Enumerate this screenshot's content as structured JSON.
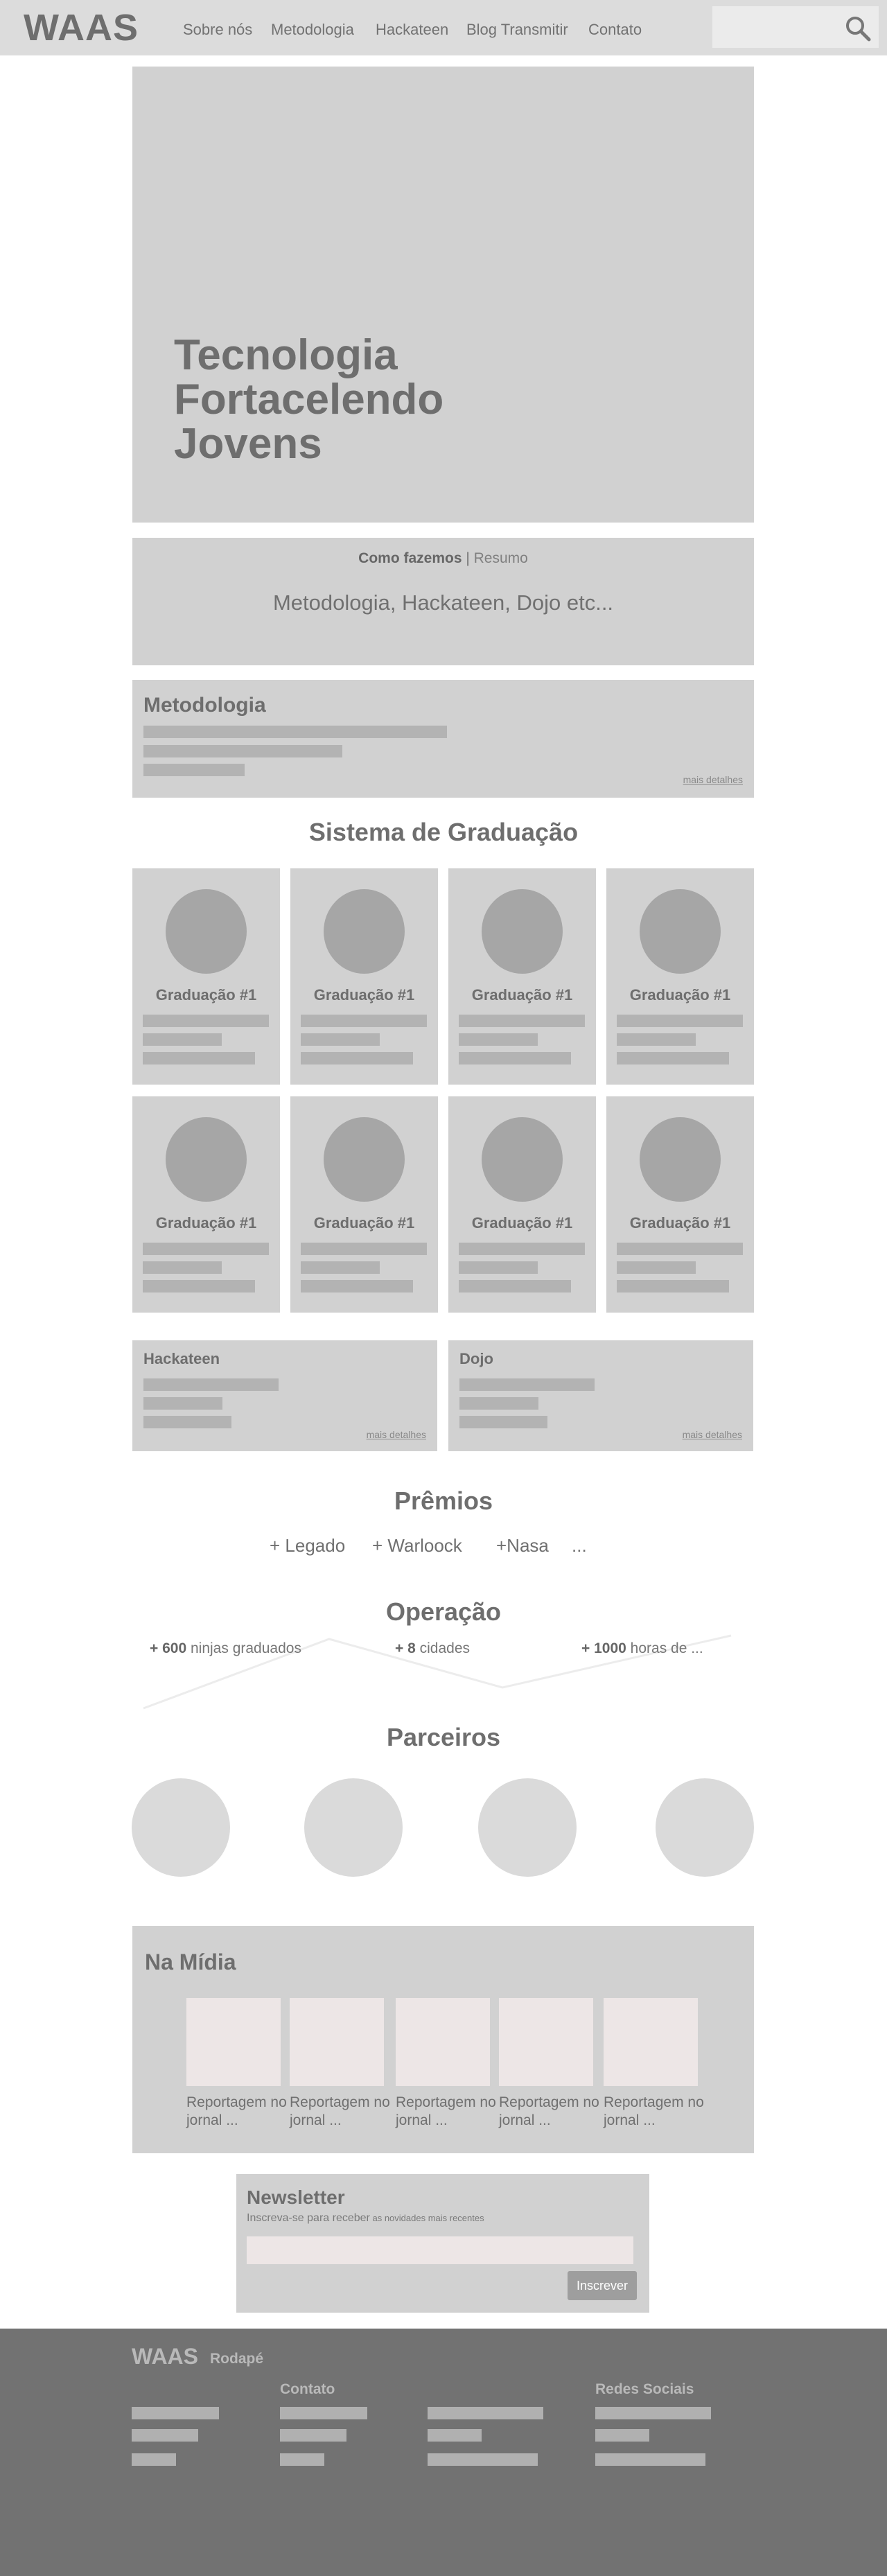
{
  "header": {
    "logo": "WAAS",
    "nav": [
      "Sobre nós",
      "Metodologia",
      "Hackateen",
      "Blog Transmitir",
      "Contato"
    ],
    "search_placeholder": ""
  },
  "hero": {
    "title_lines": [
      "Tecnologia",
      "Fortacelendo",
      "Jovens"
    ]
  },
  "how": {
    "label_bold": "Como fazemos",
    "label_sep": " | ",
    "label_rest": "Resumo",
    "subtitle": "Metodologia, Hackateen, Dojo etc..."
  },
  "metodologia": {
    "title": "Metodologia",
    "more": "mais detalhes"
  },
  "graduation": {
    "title": "Sistema de Graduação",
    "items": [
      "Graduação #1",
      "Graduação #1",
      "Graduação #1",
      "Graduação #1",
      "Graduação #1",
      "Graduação #1",
      "Graduação #1",
      "Graduação #1"
    ]
  },
  "programs": [
    {
      "title": "Hackateen",
      "more": "mais detalhes"
    },
    {
      "title": "Dojo",
      "more": "mais detalhes"
    }
  ],
  "awards": {
    "title": "Prêmios",
    "items": [
      "+ Legado",
      "+ Warloock",
      "+Nasa",
      "..."
    ]
  },
  "operation": {
    "title": "Operação",
    "stats": [
      {
        "prefix": "+ ",
        "number": "600",
        "text": " ninjas graduados"
      },
      {
        "prefix": "+ ",
        "number": "8",
        "text": " cidades"
      },
      {
        "prefix": "+ ",
        "number": "1000",
        "text": " horas de ..."
      }
    ]
  },
  "partners": {
    "title": "Parceiros",
    "count": 4
  },
  "media": {
    "title": "Na Mídia",
    "items": [
      "Reportagem no jornal ...",
      "Reportagem no jornal ...",
      "Reportagem no jornal ...",
      "Reportagem no jornal ...",
      "Reportagem no jornal ..."
    ]
  },
  "newsletter": {
    "title": "Newsletter",
    "subtitle": "Inscreva-se para receber",
    "subtitle_small": " as novidades mais recentes",
    "input_placeholder": "",
    "button": "Inscrever"
  },
  "footer": {
    "logo": "WAAS",
    "label": "Rodapé",
    "contact": "Contato",
    "social": "Redes Sociais"
  },
  "colors": {
    "placeholder": "#d1d1d1",
    "footer": "#727272",
    "circle": "#a6a6a6"
  }
}
